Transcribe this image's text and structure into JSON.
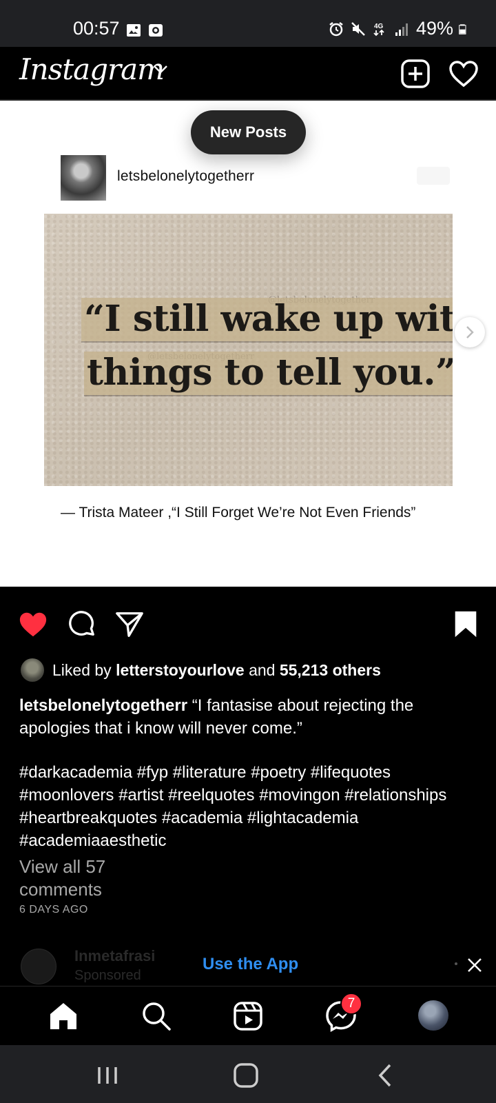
{
  "status_bar": {
    "time": "00:57",
    "battery": "49%",
    "network": "4G"
  },
  "header": {
    "logo": "Instagram",
    "icons": [
      "chevron-down-icon",
      "create-post-icon",
      "heart-icon"
    ]
  },
  "feed": {
    "new_posts_label": "New Posts",
    "embed_username": "letsbelonelytogetherr",
    "quote_line_1": "“I still wake up with",
    "quote_line_2": "things to tell you.”",
    "watermark": "@letsbelonelytogetherr",
    "attribution": "— Trista Mateer ,“I Still Forget We’re Not Even Friends”"
  },
  "post": {
    "liked_prefix": "Liked by",
    "liked_user": "letterstoyourlove",
    "liked_and": "and",
    "liked_others": "55,213 others",
    "author": "letsbelonelytogetherr",
    "caption": "“I fantasise about rejecting the apologies that i know will never come.”",
    "hashtags": "#darkacademia #fyp #literature #poetry #lifequotes #moonlovers #artist #reelquotes #movingon #relationships #heartbreakquotes #academia #lightacademia #academiaaesthetic",
    "view_comments": "View all 57 comments",
    "time_ago": "6 DAYS AGO",
    "liked": true,
    "saved": true
  },
  "next_post": {
    "name": "Inmetafrasi",
    "sponsored": "Sponsored"
  },
  "banner": {
    "use_app": "Use the App"
  },
  "bottom_nav": {
    "messenger_badge": "7"
  },
  "colors": {
    "like_red": "#ff3040",
    "link_blue": "#2f8ef0",
    "status_bar": "#202124"
  }
}
